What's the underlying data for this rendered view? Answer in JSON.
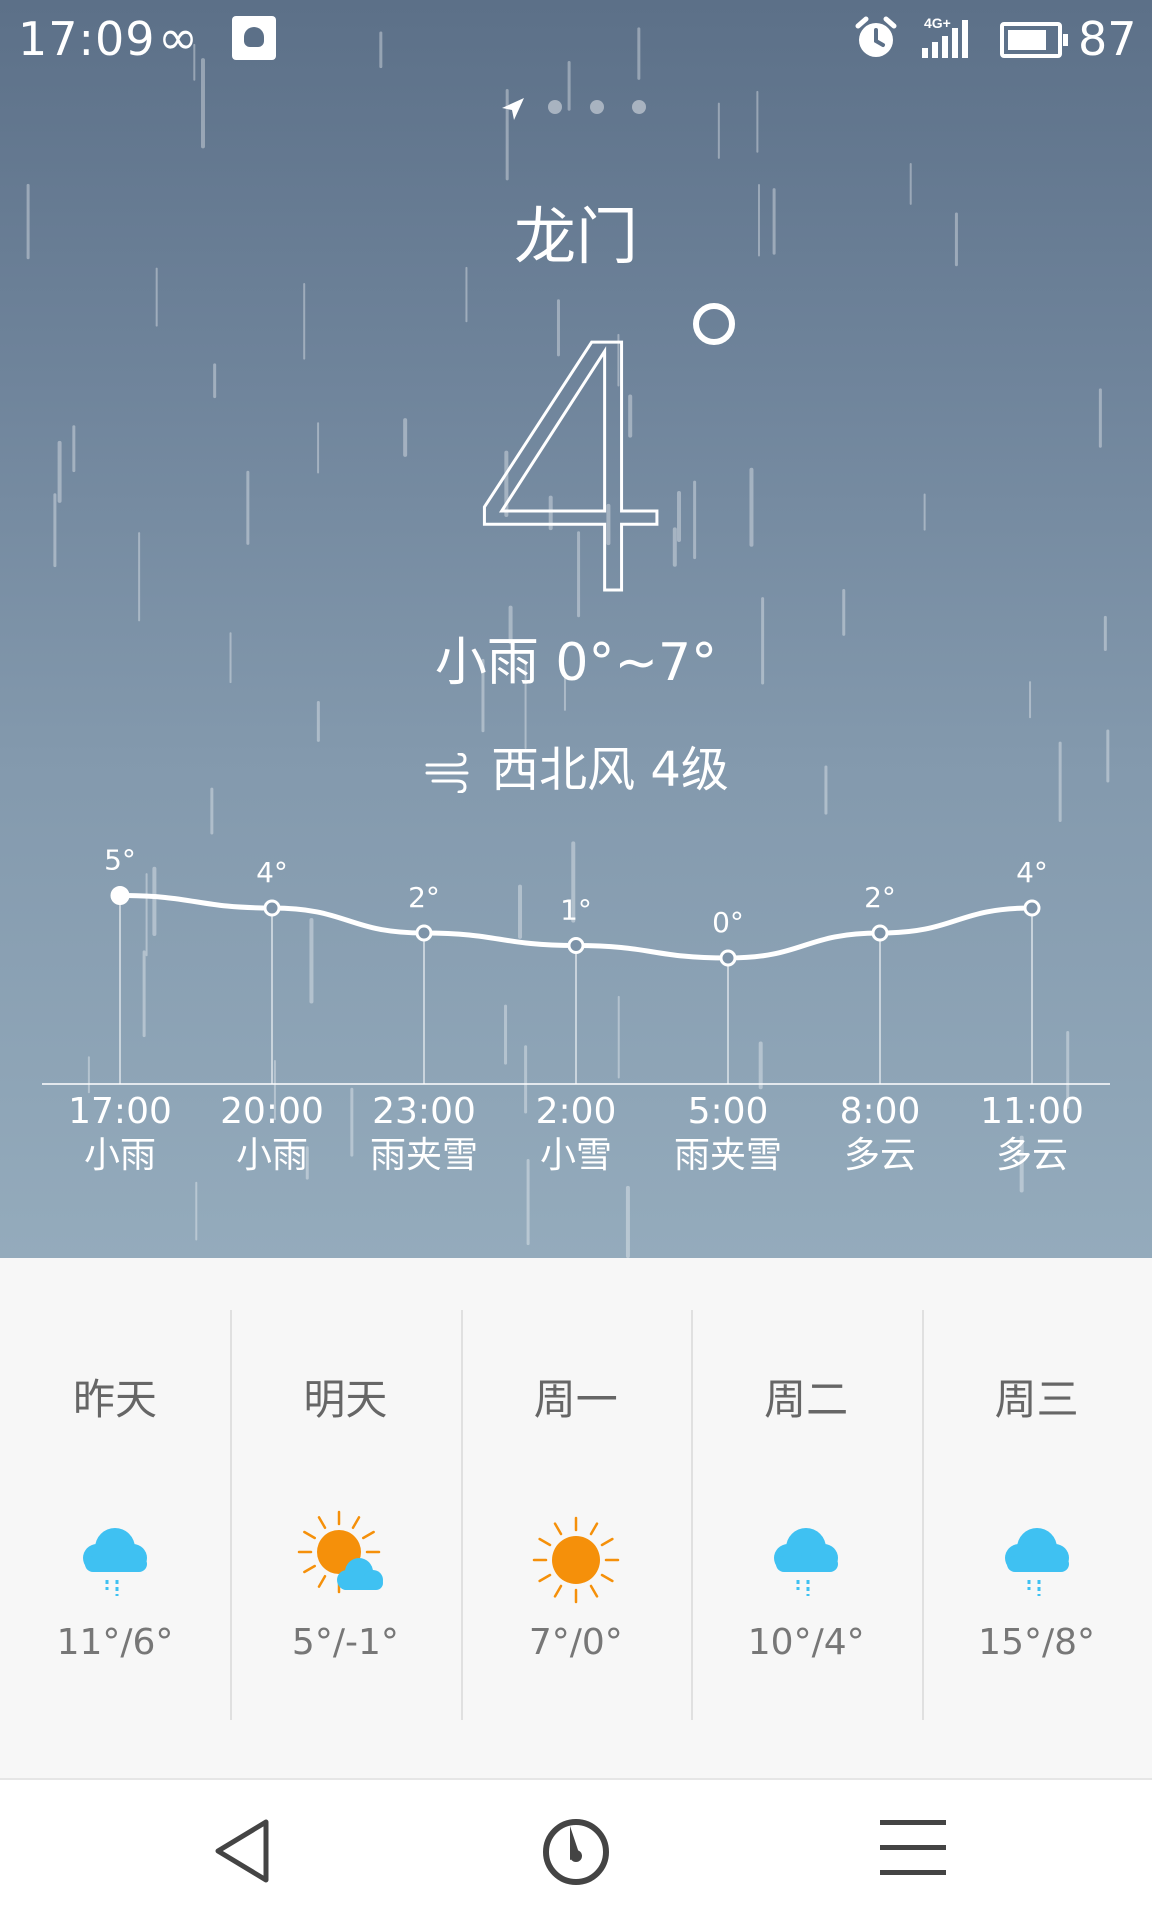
{
  "status": {
    "time": "17:09",
    "infinity": "∞",
    "battery_percent": "87",
    "network": "4G+"
  },
  "location": {
    "city": "龙门",
    "pages": 4,
    "active_page": 0
  },
  "current": {
    "temperature": "4",
    "degree": "°",
    "condition": "小雨 0°~7°",
    "wind": "西北风 4级"
  },
  "hourly": [
    {
      "time": "17:00",
      "cond": "小雨",
      "temp": "5°",
      "value": 5
    },
    {
      "time": "20:00",
      "cond": "小雨",
      "temp": "4°",
      "value": 4
    },
    {
      "time": "23:00",
      "cond": "雨夹雪",
      "temp": "2°",
      "value": 2
    },
    {
      "time": "2:00",
      "cond": "小雪",
      "temp": "1°",
      "value": 1
    },
    {
      "time": "5:00",
      "cond": "雨夹雪",
      "temp": "0°",
      "value": 0
    },
    {
      "time": "8:00",
      "cond": "多云",
      "temp": "2°",
      "value": 2
    },
    {
      "time": "11:00",
      "cond": "多云",
      "temp": "4°",
      "value": 4
    }
  ],
  "daily": [
    {
      "label": "昨天",
      "icon": "rain-icon",
      "range": "11°/6°"
    },
    {
      "label": "明天",
      "icon": "partly-cloudy-icon",
      "range": "5°/-1°"
    },
    {
      "label": "周一",
      "icon": "sunny-icon",
      "range": "7°/0°"
    },
    {
      "label": "周二",
      "icon": "rain-icon",
      "range": "10°/4°"
    },
    {
      "label": "周三",
      "icon": "rain-icon",
      "range": "15°/8°"
    }
  ],
  "colors": {
    "rain_blue": "#3fc1f2",
    "sun_orange": "#f5900a",
    "sky_top": "#5c7088",
    "sky_bottom": "#94abbc"
  }
}
